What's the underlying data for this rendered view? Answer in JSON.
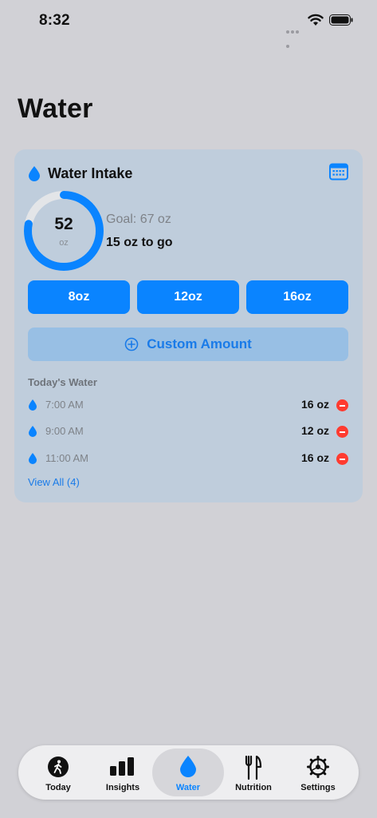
{
  "status": {
    "time": "8:32"
  },
  "page": {
    "title": "Water"
  },
  "card": {
    "title": "Water Intake",
    "consumed_value": "52",
    "consumed_unit": "oz",
    "progress_fraction": 0.78,
    "goal_text": "Goal: 67 oz",
    "remaining_text": "15 oz to go",
    "quick_add": [
      "8oz",
      "12oz",
      "16oz"
    ],
    "custom_label": "Custom Amount",
    "section_label": "Today's Water",
    "entries": [
      {
        "time": "7:00 AM",
        "amount": "16 oz"
      },
      {
        "time": "9:00 AM",
        "amount": "12 oz"
      },
      {
        "time": "11:00 AM",
        "amount": "16 oz"
      }
    ],
    "view_all": "View All (4)"
  },
  "tabs": [
    {
      "label": "Today",
      "icon": "figure-walk-icon"
    },
    {
      "label": "Insights",
      "icon": "bar-chart-icon"
    },
    {
      "label": "Water",
      "icon": "water-drop-icon",
      "active": true
    },
    {
      "label": "Nutrition",
      "icon": "fork-knife-icon"
    },
    {
      "label": "Settings",
      "icon": "gear-icon"
    }
  ],
  "colors": {
    "accent": "#0a84ff",
    "card_background": "#bfcddc",
    "page_background": "#d1d1d6",
    "delete": "#ff3b30"
  }
}
